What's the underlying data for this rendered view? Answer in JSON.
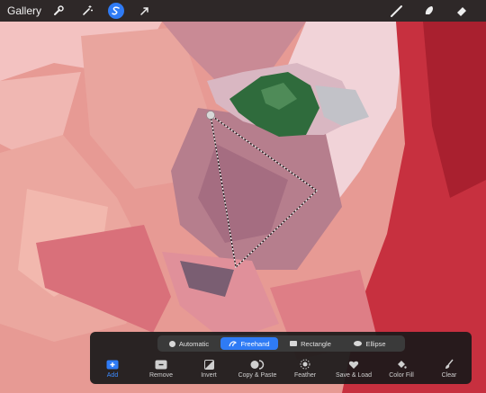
{
  "toolbar": {
    "gallery_label": "Gallery",
    "left_icons": [
      "wrench-icon",
      "magic-wand-icon",
      "selection-icon",
      "transform-arrow-icon"
    ],
    "active_icon": "selection-icon",
    "right_icons": [
      "brush-icon",
      "smudge-icon",
      "eraser-icon"
    ]
  },
  "selection_modes": {
    "items": [
      {
        "label": "Automatic",
        "icon": "circle-icon"
      },
      {
        "label": "Freehand",
        "icon": "freehand-icon"
      },
      {
        "label": "Rectangle",
        "icon": "rectangle-icon"
      },
      {
        "label": "Ellipse",
        "icon": "ellipse-icon"
      }
    ],
    "active": "Freehand"
  },
  "actions": [
    {
      "label": "Add",
      "icon": "add-icon"
    },
    {
      "label": "Remove",
      "icon": "remove-icon"
    },
    {
      "label": "Invert",
      "icon": "invert-icon"
    },
    {
      "label": "Copy & Paste",
      "icon": "copy-paste-icon"
    },
    {
      "label": "Feather",
      "icon": "feather-icon"
    },
    {
      "label": "Save & Load",
      "icon": "heart-icon"
    },
    {
      "label": "Color Fill",
      "icon": "fill-icon"
    },
    {
      "label": "Clear",
      "icon": "clear-icon"
    }
  ],
  "colors": {
    "accent": "#2f7bf5",
    "panel": "#1e1e1e"
  }
}
